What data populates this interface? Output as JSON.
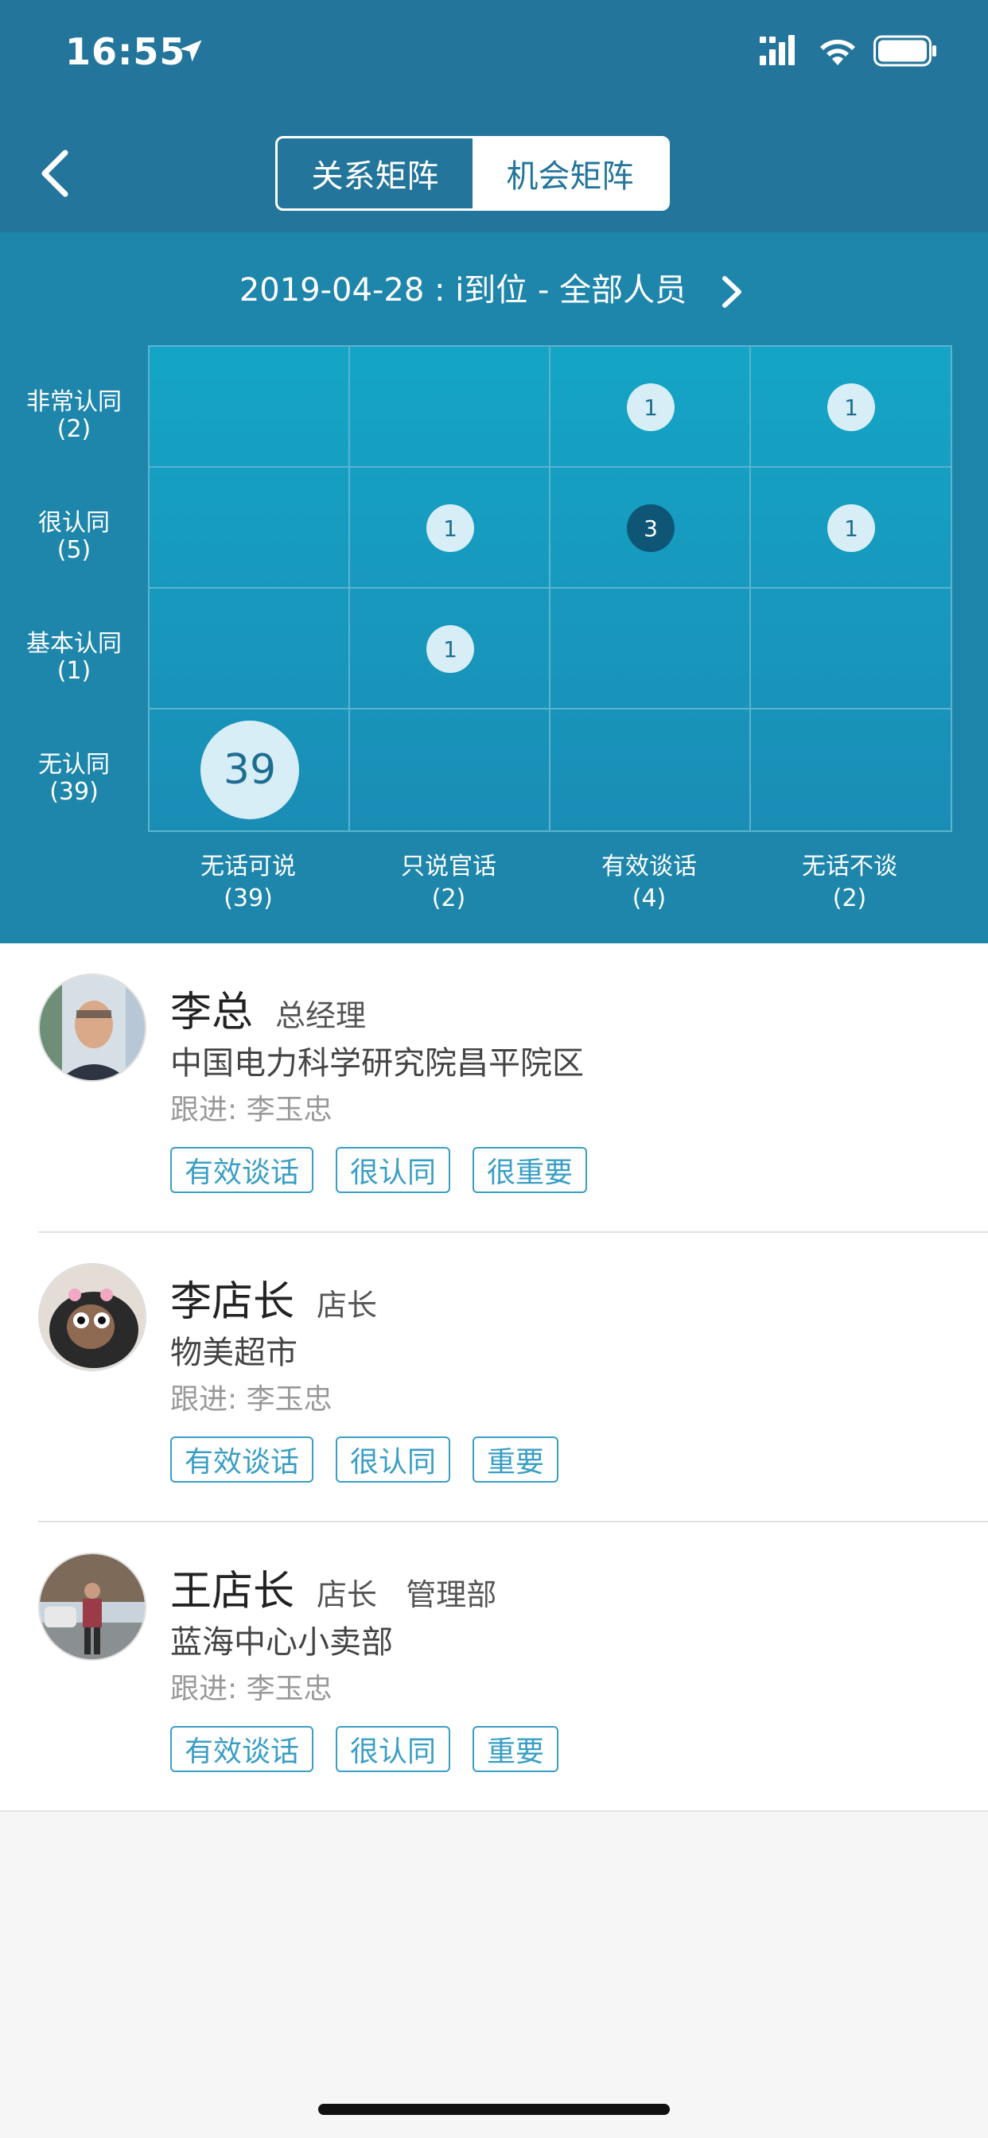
{
  "status_bar": {
    "time": "16:55"
  },
  "header": {
    "segments": [
      {
        "label": "关系矩阵",
        "active": false
      },
      {
        "label": "机会矩阵",
        "active": true
      }
    ]
  },
  "matrix": {
    "date_line": "2019-04-28 : i到位 - 全部人员",
    "rows": [
      {
        "label": "非常认同",
        "count": "(2)"
      },
      {
        "label": "很认同",
        "count": "(5)"
      },
      {
        "label": "基本认同",
        "count": "(1)"
      },
      {
        "label": "无认同",
        "count": "(39)"
      }
    ],
    "cols": [
      {
        "label": "无话可说",
        "count": "(39)"
      },
      {
        "label": "只说官话",
        "count": "(2)"
      },
      {
        "label": "有效谈话",
        "count": "(4)"
      },
      {
        "label": "无话不谈",
        "count": "(2)"
      }
    ],
    "cells": [
      {
        "row": 0,
        "col": 2,
        "value": "1",
        "style": "normal"
      },
      {
        "row": 0,
        "col": 3,
        "value": "1",
        "style": "normal"
      },
      {
        "row": 1,
        "col": 1,
        "value": "1",
        "style": "normal"
      },
      {
        "row": 1,
        "col": 2,
        "value": "3",
        "style": "dark"
      },
      {
        "row": 1,
        "col": 3,
        "value": "1",
        "style": "normal"
      },
      {
        "row": 2,
        "col": 1,
        "value": "1",
        "style": "normal"
      },
      {
        "row": 3,
        "col": 0,
        "value": "39",
        "style": "big"
      }
    ]
  },
  "contacts": [
    {
      "name": "李总",
      "title": "总经理",
      "company": "中国电力科学研究院昌平院区",
      "follow": "跟进:  李玉忠",
      "tags": [
        "有效谈话",
        "很认同",
        "很重要"
      ]
    },
    {
      "name": "李店长",
      "title": "店长",
      "company": "物美超市",
      "follow": "跟进:  李玉忠",
      "tags": [
        "有效谈话",
        "很认同",
        "重要"
      ]
    },
    {
      "name": "王店长",
      "title": "店长   管理部",
      "company": "蓝海中心小卖部",
      "follow": "跟进:  李玉忠",
      "tags": [
        "有效谈话",
        "很认同",
        "重要"
      ]
    }
  ],
  "colors": {
    "header_bg": "#23759b",
    "matrix_bg": "#1e85ab",
    "accent": "#3a9ec4"
  }
}
